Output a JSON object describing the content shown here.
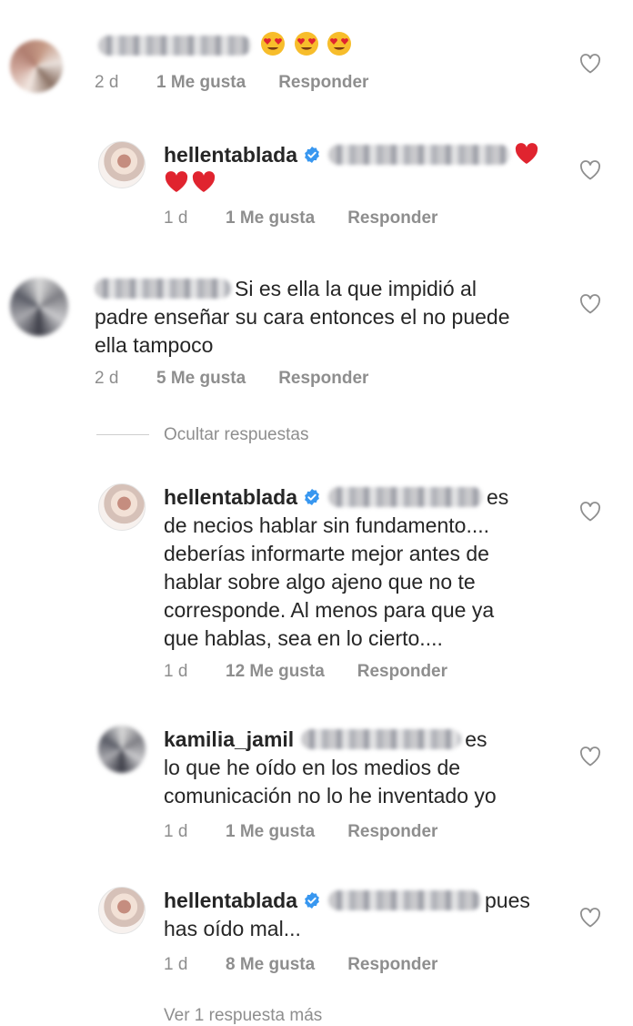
{
  "comments": [
    {
      "text": "",
      "age": "2 d",
      "likes": "1 Me gusta",
      "reply": "Responder"
    },
    {
      "username": "hellentablada",
      "text": "",
      "age": "1 d",
      "likes": "1 Me gusta",
      "reply": "Responder"
    },
    {
      "text_line1": "Si es ella la que impidió al",
      "text_line2": "padre enseñar su cara entonces el no puede",
      "text_line3": "ella tampoco",
      "age": "2 d",
      "likes": "5 Me gusta",
      "reply": "Responder"
    },
    {
      "username": "hellentablada",
      "text_tail1": "es",
      "text_line2": "de necios hablar sin fundamento....",
      "text_line3": "deberías informarte mejor antes de",
      "text_line4": "hablar sobre algo ajeno que no te",
      "text_line5": "corresponde. Al menos para que ya",
      "text_line6": "que hablas, sea en lo cierto....",
      "age": "1 d",
      "likes": "12 Me gusta",
      "reply": "Responder"
    },
    {
      "username": "kamilia_jamil",
      "text_tail1": "es",
      "text_line2": "lo que he oído en los medios de",
      "text_line3": "comunicación no lo he inventado yo",
      "age": "1 d",
      "likes": "1 Me gusta",
      "reply": "Responder"
    },
    {
      "username": "hellentablada",
      "text_tail1": "pues",
      "text_line2": "has oído mal...",
      "age": "1 d",
      "likes": "8 Me gusta",
      "reply": "Responder"
    }
  ],
  "hide_replies_label": "Ocultar respuestas",
  "view_more_label": "Ver 1 respuesta más",
  "icons": {
    "like": "heart-outline-icon",
    "verified": "verified-badge-icon",
    "emoji_hearts": "heart-eyes-emoji",
    "emoji_red_heart": "red-heart-emoji"
  },
  "colors": {
    "text": "#262626",
    "muted": "#8e8e8e",
    "verified": "#3897f0",
    "heart": "#e0242f",
    "emoji_face": "#f7bd2b"
  }
}
